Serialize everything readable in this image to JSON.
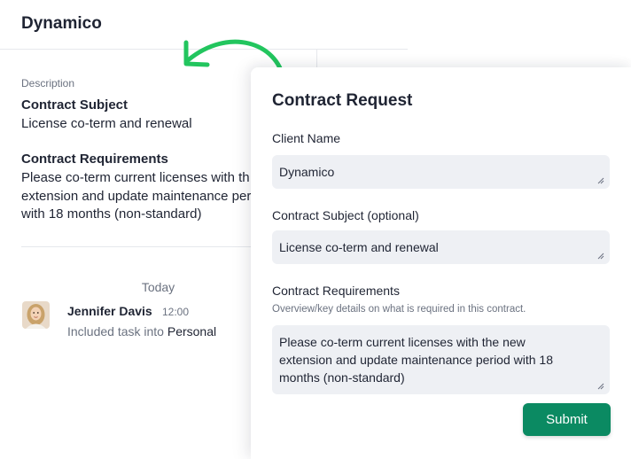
{
  "app": {
    "title": "Dynamico"
  },
  "task": {
    "description_label": "Description",
    "subject_title": "Contract Subject",
    "subject_text": "License co-term and renewal",
    "requirements_title": "Contract Requirements",
    "requirements_lines": [
      "Please co-term current licenses with th",
      "extension and update maintenance per",
      "with 18 months (non-standard)"
    ]
  },
  "activity": {
    "day_label": "Today",
    "user": "Jennifer Davis",
    "time": "12:00",
    "action": "Included task into",
    "target": "Personal"
  },
  "form": {
    "title": "Contract Request",
    "client_label": "Client Name",
    "client_value": "Dynamico",
    "subject_label": "Contract Subject (optional)",
    "subject_value": "License co-term and renewal",
    "requirements_label": "Contract Requirements",
    "requirements_help": "Overview/key details on what is required in this contract.",
    "requirements_lines": [
      "Please co-term current licenses with the new",
      "extension and update maintenance period with 18",
      "months (non-standard)"
    ],
    "submit_label": "Submit"
  },
  "colors": {
    "accent": "#0b8a62",
    "arrow": "#22c55e",
    "field_bg": "#eef0f4"
  },
  "icons": {
    "resize": "resize-grip-icon",
    "arrow": "curved-arrow-icon"
  }
}
